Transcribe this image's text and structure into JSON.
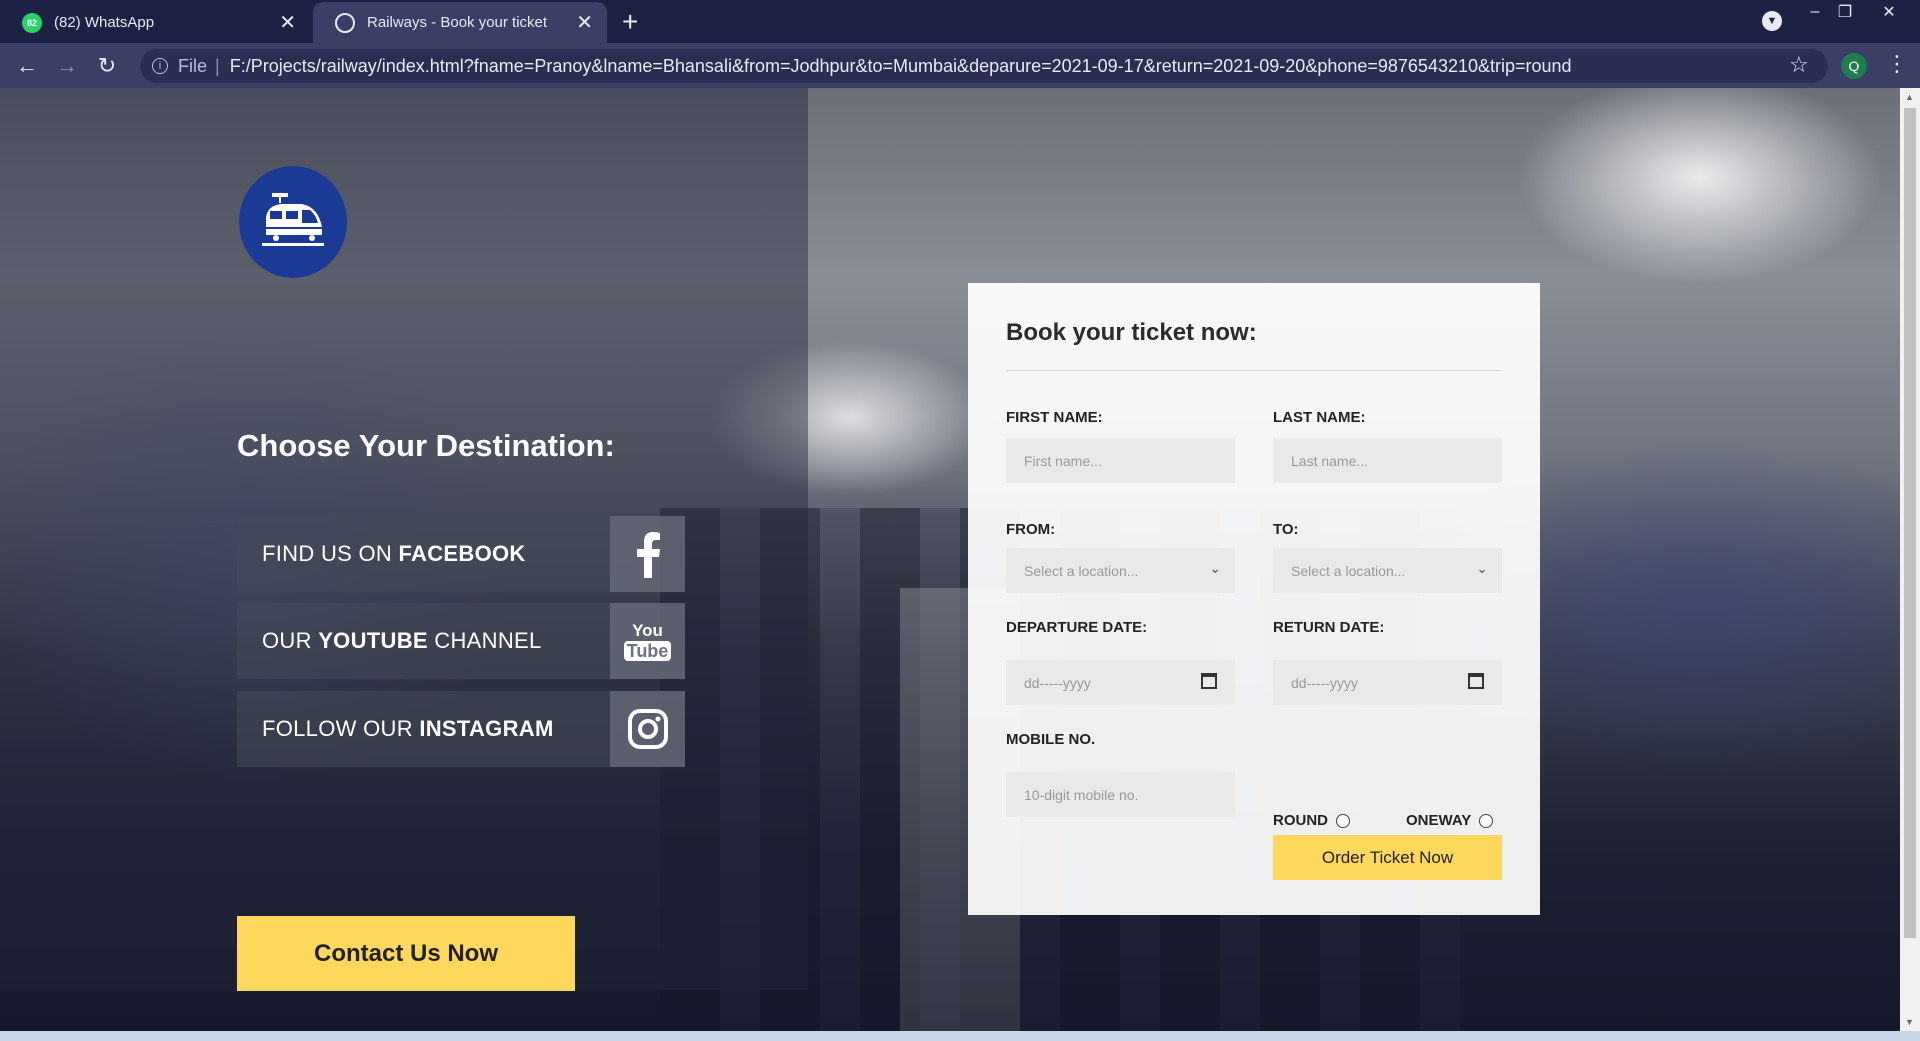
{
  "browser": {
    "tabs": [
      {
        "title": "(82) WhatsApp",
        "badge": "82"
      },
      {
        "title": "Railways - Book your ticket"
      }
    ],
    "address": {
      "scheme_label": "File",
      "url": "F:/Projects/railway/index.html?fname=Pranoy&lname=Bhansali&from=Jodhpur&to=Mumbai&deparure=2021-09-17&return=2021-09-20&phone=9876543210&trip=round"
    },
    "profile_initial": "Q"
  },
  "hero": {
    "heading": "Choose Your Destination:",
    "social": [
      {
        "pre": "FIND US ON ",
        "strong": "FACEBOOK",
        "post": "",
        "icon": "facebook-icon"
      },
      {
        "pre": "OUR ",
        "strong": "YOUTUBE",
        "post": " CHANNEL",
        "icon": "youtube-icon"
      },
      {
        "pre": "FOLLOW OUR ",
        "strong": "INSTAGRAM",
        "post": "",
        "icon": "instagram-icon"
      }
    ],
    "youtube_icon_top": "You",
    "youtube_icon_bottom": "Tube",
    "contact_label": "Contact Us Now"
  },
  "form": {
    "title": "Book your ticket now:",
    "first_name_label": "FIRST NAME:",
    "first_name_placeholder": "First name...",
    "last_name_label": "LAST NAME:",
    "last_name_placeholder": "Last name...",
    "from_label": "FROM:",
    "from_placeholder": "Select a location...",
    "to_label": "TO:",
    "to_placeholder": "Select a location...",
    "departure_label": "DEPARTURE DATE:",
    "departure_placeholder": "dd-----yyyy",
    "return_label": "RETURN DATE:",
    "return_placeholder": "dd-----yyyy",
    "mobile_label": "MOBILE NO.",
    "mobile_placeholder": "10-digit mobile no.",
    "round_label": "ROUND",
    "oneway_label": "ONEWAY",
    "submit_label": "Order Ticket Now"
  },
  "colors": {
    "accent": "#fdd85d",
    "logo": "#1a3a96",
    "chrome": "#1d2143"
  }
}
